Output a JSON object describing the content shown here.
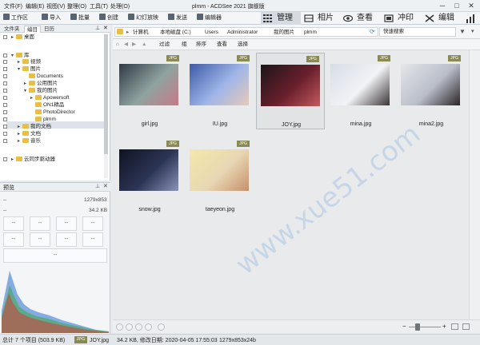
{
  "title": "plmm - ACDSee 2021 旗舰版",
  "menu": [
    "文件(F)",
    "编辑(E)",
    "视图(V)",
    "整理(O)",
    "工具(T)",
    "处理(O)"
  ],
  "window_controls": [
    "─",
    "□",
    "✕"
  ],
  "toolbar": {
    "workspace": "工作区",
    "import": "导入",
    "batch": "批量",
    "create": "创建",
    "slideshow": "幻灯放映",
    "send": "发送",
    "editor": "编辑器"
  },
  "modes": [
    "管理",
    "相片",
    "查看",
    "冲印",
    "编辑"
  ],
  "left_panel": {
    "tabs": [
      "文件夹",
      "编目",
      "日历"
    ],
    "tree": [
      {
        "label": "桌面",
        "indent": 0
      },
      {
        "label": "库",
        "indent": 0
      },
      {
        "label": "视频",
        "indent": 1
      },
      {
        "label": "图片",
        "indent": 1
      },
      {
        "label": "Documents",
        "indent": 2
      },
      {
        "label": "公用图片",
        "indent": 2
      },
      {
        "label": "我的图片",
        "indent": 2
      },
      {
        "label": "Apowersoft",
        "indent": 3
      },
      {
        "label": "ON1精品",
        "indent": 3
      },
      {
        "label": "PhotoDirector",
        "indent": 3
      },
      {
        "label": "plmm",
        "indent": 3
      },
      {
        "label": "我的文档",
        "indent": 1
      },
      {
        "label": "文档",
        "indent": 1
      },
      {
        "label": "音乐",
        "indent": 1
      },
      {
        "label": "云同步驱动器",
        "indent": 0
      }
    ]
  },
  "preview": {
    "title": "预览",
    "dims": "1279x853",
    "size": "34.2 KB",
    "dash": "--",
    "cells": [
      "--",
      "--",
      "--",
      "--",
      "--",
      "--",
      "--",
      "--"
    ],
    "wide": "--"
  },
  "address": {
    "crumbs": [
      "计算机",
      "本地磁盘 (C:)",
      "Users",
      "Administrator",
      "我的图片",
      "plmm"
    ],
    "search_label": "快速搜索"
  },
  "filter_bar": [
    "过滤",
    "组",
    "排序",
    "查看",
    "选择"
  ],
  "thumbnails": [
    {
      "name": "girl.jpg",
      "badge": "JPG",
      "colors": [
        "#2f3b46",
        "#8fa3a0",
        "#c77a86"
      ]
    },
    {
      "name": "IU.jpg",
      "badge": "JPG",
      "colors": [
        "#3e5aa8",
        "#9fb6e8",
        "#e7c9b8"
      ]
    },
    {
      "name": "JOY.jpg",
      "badge": "JPG",
      "colors": [
        "#1c1518",
        "#6a1f2c",
        "#c35a5d"
      ]
    },
    {
      "name": "mina.jpg",
      "badge": "JPG",
      "colors": [
        "#d8dde6",
        "#f1f3f6",
        "#3c3434"
      ]
    },
    {
      "name": "mina2.jpg",
      "badge": "JPG",
      "colors": [
        "#e4e6ea",
        "#b9bec8",
        "#2a2428"
      ]
    },
    {
      "name": "snow.jpg",
      "badge": "JPG",
      "colors": [
        "#0f1322",
        "#2b3454",
        "#8a94b8"
      ]
    },
    {
      "name": "taeyeon.jpg",
      "badge": "JPG",
      "colors": [
        "#f3e9a8",
        "#e8d7b3",
        "#c6906c"
      ]
    }
  ],
  "status": {
    "total": "总计 7 个项目 (503.9 KB)",
    "badge": "JPG",
    "file": "JOY.jpg",
    "info": "34.2 KB, 修改日期: 2020-04-05 17:55:03",
    "dims": "1279x853x24b"
  },
  "watermark": "www.xue51.com",
  "colors": {
    "accent": "#4a90d9",
    "badge": "#8a8a55",
    "selected": "#dde3e9"
  }
}
